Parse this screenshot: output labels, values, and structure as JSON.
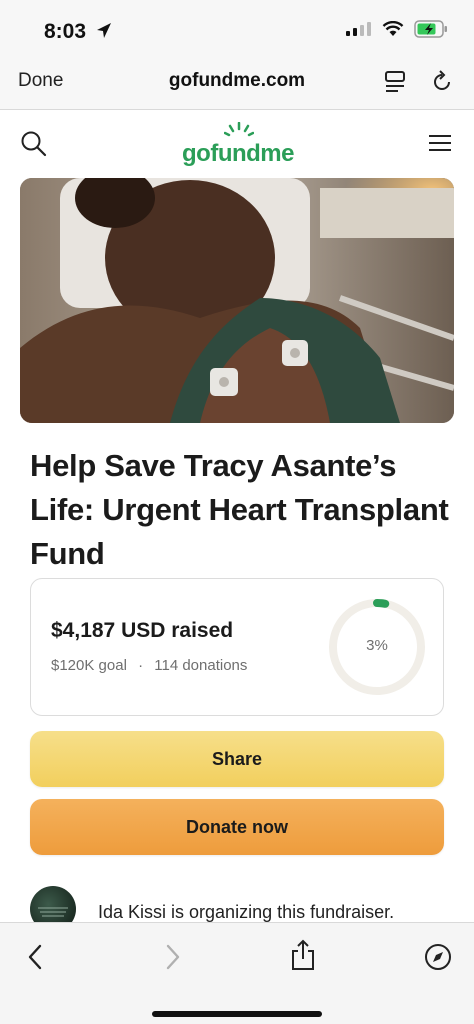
{
  "status_bar": {
    "time": "8:03"
  },
  "browser": {
    "done_label": "Done",
    "url": "gofundme.com"
  },
  "site": {
    "logo_text": "gofundme",
    "brand_color": "#2b9e58"
  },
  "campaign": {
    "title": "Help Save Tracy Asante’s Life: Urgent Heart Transplant Fund",
    "raised": "$4,187 USD raised",
    "goal": "$120K goal",
    "separator": "·",
    "donations": "114 donations",
    "progress_label": "3%",
    "progress_fraction": 0.03
  },
  "actions": {
    "share_label": "Share",
    "donate_label": "Donate now"
  },
  "organizer": {
    "text": "Ida Kissi is organizing this fundraiser."
  },
  "icons": [
    "location-arrow-icon",
    "signal-icon",
    "wifi-icon",
    "battery-icon",
    "reader-mode-icon",
    "reload-icon",
    "search-icon",
    "menu-icon",
    "back-icon",
    "forward-icon",
    "share-icon",
    "compass-icon"
  ]
}
